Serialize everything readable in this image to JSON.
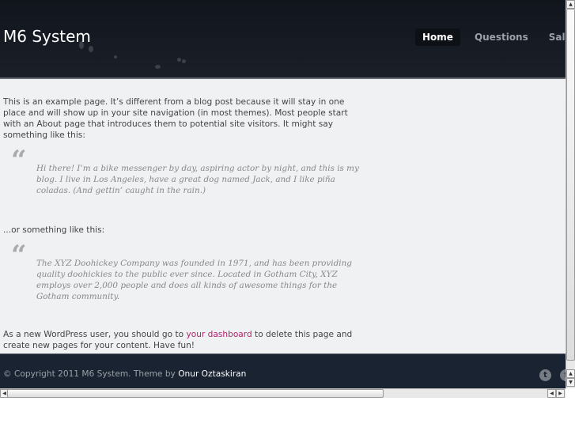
{
  "header": {
    "site_title": "M6 System",
    "nav": [
      {
        "label": "Home",
        "active": true
      },
      {
        "label": "Questions",
        "active": false
      },
      {
        "label": "Sales",
        "active": false
      }
    ]
  },
  "content": {
    "intro": "This is an example page. It’s different from a blog post because it will stay in one place and will show up in your site navigation (in most themes). Most people start with an About page that introduces them to potential site visitors. It might say something like this:",
    "quote1": "Hi there! I’m a bike messenger by day, aspiring actor by night, and this is my blog. I live in Los Angeles, have a great dog named Jack, and I like piña coladas. (And gettin’ caught in the rain.)",
    "or_text": "...or something like this:",
    "quote2": "The XYZ Doohickey Company was founded in 1971, and has been providing quality doohickies to the public ever since. Located in Gotham City, XYZ employs over 2,000 people and does all kinds of awesome things for the Gotham community.",
    "outro_before": "As a new WordPress user, you should go to ",
    "outro_link": "your dashboard",
    "outro_after": " to delete this page and create new pages for your content. Have fun!",
    "quote_mark": "“"
  },
  "footer": {
    "copyright": "© Copyright 2011 M6 System. Theme by ",
    "author_link": "Onur Oztaskiran",
    "icons": [
      "twitter-icon",
      "facebook-icon"
    ]
  },
  "colors": {
    "header_bg": "#151a22",
    "content_bg": "#f0f1f3",
    "footer_bg": "#1a2331",
    "link": "#b0246a"
  }
}
